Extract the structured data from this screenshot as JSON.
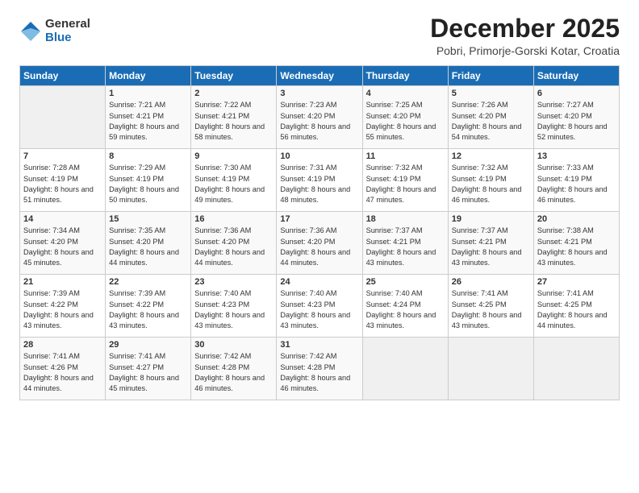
{
  "logo": {
    "general": "General",
    "blue": "Blue"
  },
  "header": {
    "month": "December 2025",
    "location": "Pobri, Primorje-Gorski Kotar, Croatia"
  },
  "weekdays": [
    "Sunday",
    "Monday",
    "Tuesday",
    "Wednesday",
    "Thursday",
    "Friday",
    "Saturday"
  ],
  "weeks": [
    [
      {
        "day": "",
        "sunrise": "",
        "sunset": "",
        "daylight": ""
      },
      {
        "day": "1",
        "sunrise": "Sunrise: 7:21 AM",
        "sunset": "Sunset: 4:21 PM",
        "daylight": "Daylight: 8 hours and 59 minutes."
      },
      {
        "day": "2",
        "sunrise": "Sunrise: 7:22 AM",
        "sunset": "Sunset: 4:21 PM",
        "daylight": "Daylight: 8 hours and 58 minutes."
      },
      {
        "day": "3",
        "sunrise": "Sunrise: 7:23 AM",
        "sunset": "Sunset: 4:20 PM",
        "daylight": "Daylight: 8 hours and 56 minutes."
      },
      {
        "day": "4",
        "sunrise": "Sunrise: 7:25 AM",
        "sunset": "Sunset: 4:20 PM",
        "daylight": "Daylight: 8 hours and 55 minutes."
      },
      {
        "day": "5",
        "sunrise": "Sunrise: 7:26 AM",
        "sunset": "Sunset: 4:20 PM",
        "daylight": "Daylight: 8 hours and 54 minutes."
      },
      {
        "day": "6",
        "sunrise": "Sunrise: 7:27 AM",
        "sunset": "Sunset: 4:20 PM",
        "daylight": "Daylight: 8 hours and 52 minutes."
      }
    ],
    [
      {
        "day": "7",
        "sunrise": "Sunrise: 7:28 AM",
        "sunset": "Sunset: 4:19 PM",
        "daylight": "Daylight: 8 hours and 51 minutes."
      },
      {
        "day": "8",
        "sunrise": "Sunrise: 7:29 AM",
        "sunset": "Sunset: 4:19 PM",
        "daylight": "Daylight: 8 hours and 50 minutes."
      },
      {
        "day": "9",
        "sunrise": "Sunrise: 7:30 AM",
        "sunset": "Sunset: 4:19 PM",
        "daylight": "Daylight: 8 hours and 49 minutes."
      },
      {
        "day": "10",
        "sunrise": "Sunrise: 7:31 AM",
        "sunset": "Sunset: 4:19 PM",
        "daylight": "Daylight: 8 hours and 48 minutes."
      },
      {
        "day": "11",
        "sunrise": "Sunrise: 7:32 AM",
        "sunset": "Sunset: 4:19 PM",
        "daylight": "Daylight: 8 hours and 47 minutes."
      },
      {
        "day": "12",
        "sunrise": "Sunrise: 7:32 AM",
        "sunset": "Sunset: 4:19 PM",
        "daylight": "Daylight: 8 hours and 46 minutes."
      },
      {
        "day": "13",
        "sunrise": "Sunrise: 7:33 AM",
        "sunset": "Sunset: 4:19 PM",
        "daylight": "Daylight: 8 hours and 46 minutes."
      }
    ],
    [
      {
        "day": "14",
        "sunrise": "Sunrise: 7:34 AM",
        "sunset": "Sunset: 4:20 PM",
        "daylight": "Daylight: 8 hours and 45 minutes."
      },
      {
        "day": "15",
        "sunrise": "Sunrise: 7:35 AM",
        "sunset": "Sunset: 4:20 PM",
        "daylight": "Daylight: 8 hours and 44 minutes."
      },
      {
        "day": "16",
        "sunrise": "Sunrise: 7:36 AM",
        "sunset": "Sunset: 4:20 PM",
        "daylight": "Daylight: 8 hours and 44 minutes."
      },
      {
        "day": "17",
        "sunrise": "Sunrise: 7:36 AM",
        "sunset": "Sunset: 4:20 PM",
        "daylight": "Daylight: 8 hours and 44 minutes."
      },
      {
        "day": "18",
        "sunrise": "Sunrise: 7:37 AM",
        "sunset": "Sunset: 4:21 PM",
        "daylight": "Daylight: 8 hours and 43 minutes."
      },
      {
        "day": "19",
        "sunrise": "Sunrise: 7:37 AM",
        "sunset": "Sunset: 4:21 PM",
        "daylight": "Daylight: 8 hours and 43 minutes."
      },
      {
        "day": "20",
        "sunrise": "Sunrise: 7:38 AM",
        "sunset": "Sunset: 4:21 PM",
        "daylight": "Daylight: 8 hours and 43 minutes."
      }
    ],
    [
      {
        "day": "21",
        "sunrise": "Sunrise: 7:39 AM",
        "sunset": "Sunset: 4:22 PM",
        "daylight": "Daylight: 8 hours and 43 minutes."
      },
      {
        "day": "22",
        "sunrise": "Sunrise: 7:39 AM",
        "sunset": "Sunset: 4:22 PM",
        "daylight": "Daylight: 8 hours and 43 minutes."
      },
      {
        "day": "23",
        "sunrise": "Sunrise: 7:40 AM",
        "sunset": "Sunset: 4:23 PM",
        "daylight": "Daylight: 8 hours and 43 minutes."
      },
      {
        "day": "24",
        "sunrise": "Sunrise: 7:40 AM",
        "sunset": "Sunset: 4:23 PM",
        "daylight": "Daylight: 8 hours and 43 minutes."
      },
      {
        "day": "25",
        "sunrise": "Sunrise: 7:40 AM",
        "sunset": "Sunset: 4:24 PM",
        "daylight": "Daylight: 8 hours and 43 minutes."
      },
      {
        "day": "26",
        "sunrise": "Sunrise: 7:41 AM",
        "sunset": "Sunset: 4:25 PM",
        "daylight": "Daylight: 8 hours and 43 minutes."
      },
      {
        "day": "27",
        "sunrise": "Sunrise: 7:41 AM",
        "sunset": "Sunset: 4:25 PM",
        "daylight": "Daylight: 8 hours and 44 minutes."
      }
    ],
    [
      {
        "day": "28",
        "sunrise": "Sunrise: 7:41 AM",
        "sunset": "Sunset: 4:26 PM",
        "daylight": "Daylight: 8 hours and 44 minutes."
      },
      {
        "day": "29",
        "sunrise": "Sunrise: 7:41 AM",
        "sunset": "Sunset: 4:27 PM",
        "daylight": "Daylight: 8 hours and 45 minutes."
      },
      {
        "day": "30",
        "sunrise": "Sunrise: 7:42 AM",
        "sunset": "Sunset: 4:28 PM",
        "daylight": "Daylight: 8 hours and 46 minutes."
      },
      {
        "day": "31",
        "sunrise": "Sunrise: 7:42 AM",
        "sunset": "Sunset: 4:28 PM",
        "daylight": "Daylight: 8 hours and 46 minutes."
      },
      {
        "day": "",
        "sunrise": "",
        "sunset": "",
        "daylight": ""
      },
      {
        "day": "",
        "sunrise": "",
        "sunset": "",
        "daylight": ""
      },
      {
        "day": "",
        "sunrise": "",
        "sunset": "",
        "daylight": ""
      }
    ]
  ]
}
